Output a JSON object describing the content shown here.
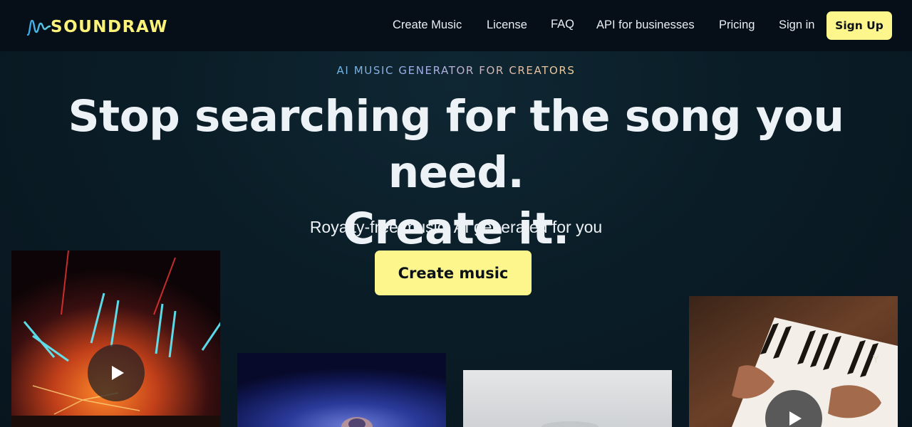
{
  "brand": {
    "name": "SOUNDRAW",
    "logo_icon": "waveform-logo-icon",
    "accent": "#fdf68d"
  },
  "nav": {
    "links": [
      "Create Music",
      "License",
      "FAQ",
      "API for businesses",
      "Pricing",
      "Sign in"
    ],
    "signup_label": "Sign Up"
  },
  "hero": {
    "eyebrow": "AI MUSIC GENERATOR FOR CREATORS",
    "headline_line1": "Stop searching for the song you need.",
    "headline_line2": "Create it.",
    "subhead": "Royalty-free music, AI generated for you",
    "cta_label": "Create music"
  },
  "cards": [
    {
      "subject": "concert lights",
      "icon": "play-icon"
    },
    {
      "subject": "singer under blue light"
    },
    {
      "subject": "misty landscape"
    },
    {
      "subject": "piano hands",
      "icon": "play-icon"
    }
  ],
  "colors": {
    "background": "#08141d",
    "nav_bg": "#060e17",
    "button": "#fdf68d"
  }
}
